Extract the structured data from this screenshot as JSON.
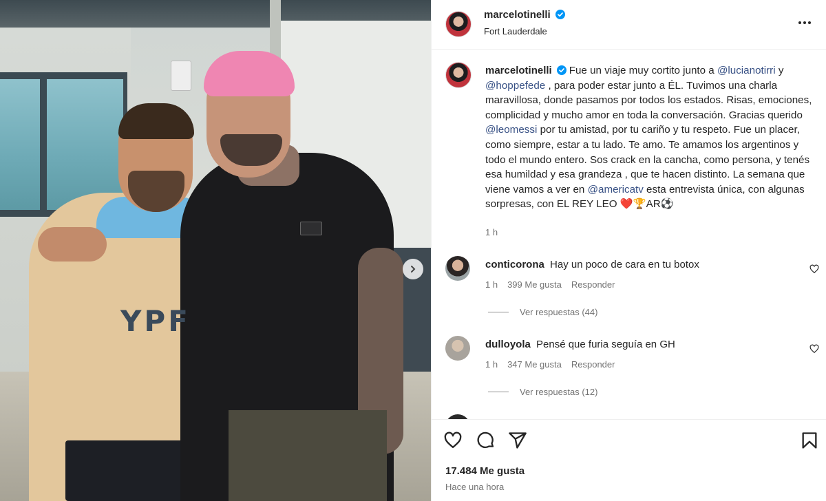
{
  "post": {
    "username": "marcelotinelli",
    "location": "Fort Lauderdale",
    "photo_text": "YPF",
    "caption": {
      "segments": [
        {
          "t": "text",
          "v": "Fue un viaje muy cortito junto a "
        },
        {
          "t": "mention",
          "v": "@lucianotirri"
        },
        {
          "t": "text",
          "v": " y "
        },
        {
          "t": "mention",
          "v": "@hoppefede"
        },
        {
          "t": "text",
          "v": " , para poder estar junto a ÉL. Tuvimos una charla maravillosa, donde pasamos por todos los estados. Risas, emociones, complicidad y mucho amor en toda la conversación. Gracias querido "
        },
        {
          "t": "mention",
          "v": "@leomessi"
        },
        {
          "t": "text",
          "v": " por tu amistad, por tu cariño y tu respeto. Fue un placer, como siempre, estar a tu lado. Te amo. Te amamos los argentinos y todo el mundo entero. Sos crack en la cancha, como persona, y tenés esa humildad y esa grandeza , que te hacen distinto. La semana que viene vamos a ver en "
        },
        {
          "t": "mention",
          "v": "@americatv"
        },
        {
          "t": "text",
          "v": " esta entrevista única, con algunas sorpresas, con EL REY LEO ❤️🏆AR⚽"
        }
      ],
      "time": "1 h"
    },
    "likes": "17.484 Me gusta",
    "posted_ago": "Hace una hora"
  },
  "comments": [
    {
      "username": "conticorona",
      "text": "Hay un poco de cara en tu botox",
      "time": "1 h",
      "likes": "399 Me gusta",
      "reply_label": "Responder",
      "view_replies": "Ver respuestas (44)"
    },
    {
      "username": "dulloyola",
      "text": "Pensé que furia seguía en GH",
      "time": "1 h",
      "likes": "347 Me gusta",
      "reply_label": "Responder",
      "view_replies": "Ver respuestas (12)"
    }
  ],
  "icons": {
    "verified": "verified-badge-icon",
    "more": "more-options-icon",
    "next": "chevron-right-icon",
    "like": "heart-icon",
    "comment": "comment-icon",
    "share": "share-icon",
    "save": "bookmark-icon"
  },
  "colors": {
    "verified": "#0095f6",
    "mention": "#385185",
    "muted": "#737373",
    "text": "#262626"
  }
}
